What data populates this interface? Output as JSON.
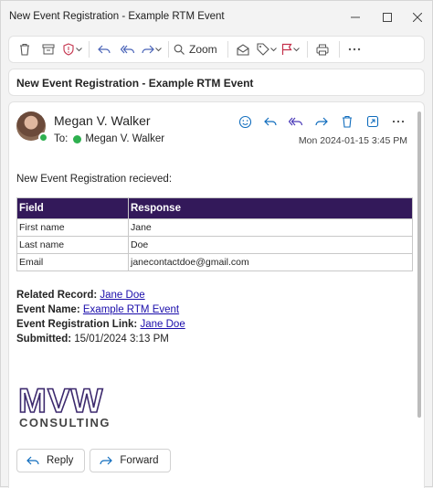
{
  "window": {
    "title": "New Event Registration - Example RTM Event"
  },
  "toolbar": {
    "zoom_label": "Zoom",
    "icons": [
      "delete-icon",
      "archive-icon",
      "report-icon",
      "reply-icon",
      "reply-all-icon",
      "forward-icon",
      "zoom-icon",
      "read-unread-icon",
      "tag-icon",
      "flag-icon",
      "print-icon",
      "more-icon"
    ]
  },
  "message": {
    "subject": "New Event Registration - Example RTM Event",
    "sender": "Megan V. Walker",
    "to_label": "To:",
    "recipient": "Megan V. Walker",
    "date": "Mon 2024-01-15 3:45 PM",
    "intro": "New Event Registration recieved:",
    "table": {
      "headers": [
        "Field",
        "Response"
      ],
      "rows": [
        [
          "First name",
          "Jane"
        ],
        [
          "Last name",
          "Doe"
        ],
        [
          "Email",
          "janecontactdoe@gmail.com"
        ]
      ]
    },
    "details": {
      "related_label": "Related Record:",
      "related_link": "Jane Doe",
      "event_label": "Event Name:",
      "event_link": "Example RTM Event",
      "reg_label": "Event Registration Link:",
      "reg_link": "Jane Doe",
      "submitted_label": "Submitted:",
      "submitted_value": "15/01/2024 3:13 PM"
    },
    "logo": {
      "top": "MVW",
      "bottom": "CONSULTING"
    }
  },
  "reply_buttons": {
    "reply": "Reply",
    "forward": "Forward"
  },
  "colors": {
    "header_purple": "#33195a",
    "accent_blue": "#0f6cbd",
    "link": "#1a0dab",
    "presence_green": "#2eb04f"
  }
}
